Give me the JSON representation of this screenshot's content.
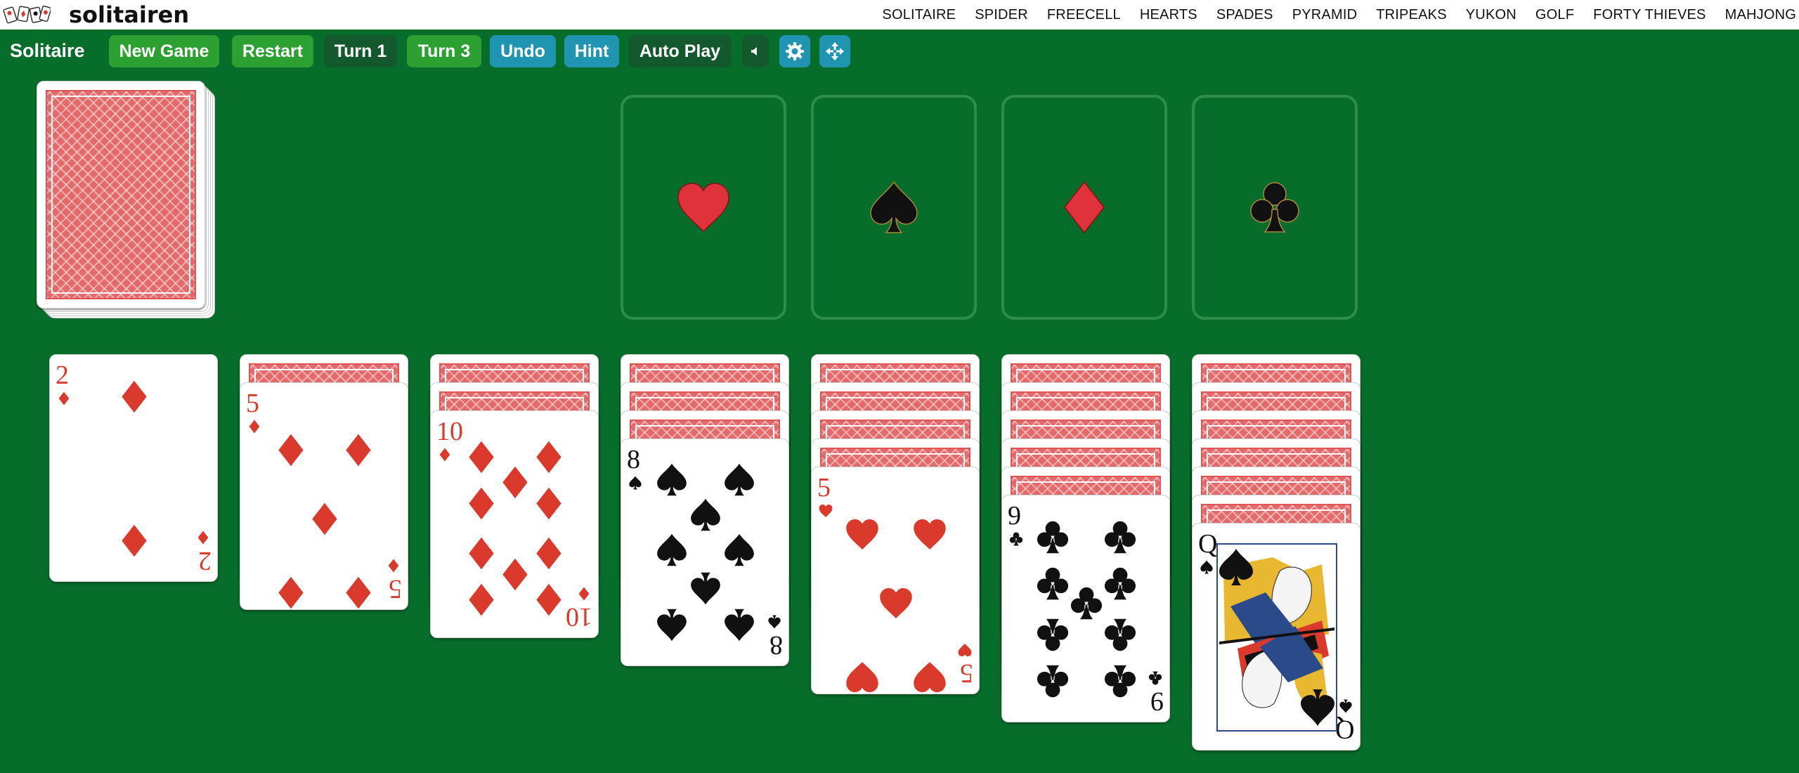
{
  "brand": {
    "name": "solitairen",
    "logo_icon": "cards-logo-icon"
  },
  "nav": [
    "SOLITAIRE",
    "SPIDER",
    "FREECELL",
    "HEARTS",
    "SPADES",
    "PYRAMID",
    "TRIPEAKS",
    "YUKON",
    "GOLF",
    "FORTY THIEVES",
    "MAHJONG"
  ],
  "toolbar": {
    "title": "Solitaire",
    "new_game": "New Game",
    "restart": "Restart",
    "turn1": "Turn 1",
    "turn3": "Turn 3",
    "undo": "Undo",
    "hint": "Hint",
    "auto_play": "Auto Play",
    "sound_icon": "speaker-icon",
    "settings_icon": "gear-icon",
    "fullscreen_icon": "move-arrows-icon"
  },
  "foundations": [
    {
      "suit": "hearts",
      "color": "red"
    },
    {
      "suit": "spades",
      "color": "black"
    },
    {
      "suit": "diamonds",
      "color": "red"
    },
    {
      "suit": "clubs",
      "color": "black"
    }
  ],
  "tableau": [
    {
      "facedown": 0,
      "top": {
        "rank": "2",
        "suit": "diamonds"
      }
    },
    {
      "facedown": 1,
      "top": {
        "rank": "5",
        "suit": "diamonds"
      }
    },
    {
      "facedown": 2,
      "top": {
        "rank": "10",
        "suit": "diamonds"
      }
    },
    {
      "facedown": 3,
      "top": {
        "rank": "8",
        "suit": "spades"
      }
    },
    {
      "facedown": 4,
      "top": {
        "rank": "5",
        "suit": "hearts"
      }
    },
    {
      "facedown": 5,
      "top": {
        "rank": "9",
        "suit": "clubs"
      }
    },
    {
      "facedown": 6,
      "top": {
        "rank": "Q",
        "suit": "spades"
      }
    }
  ],
  "colors": {
    "felt": "#076d2b",
    "red_suit": "#d93a2b",
    "black_suit": "#111111",
    "button_green": "#2ca132",
    "button_dark": "#13592d",
    "button_blue": "#1f95b2"
  }
}
